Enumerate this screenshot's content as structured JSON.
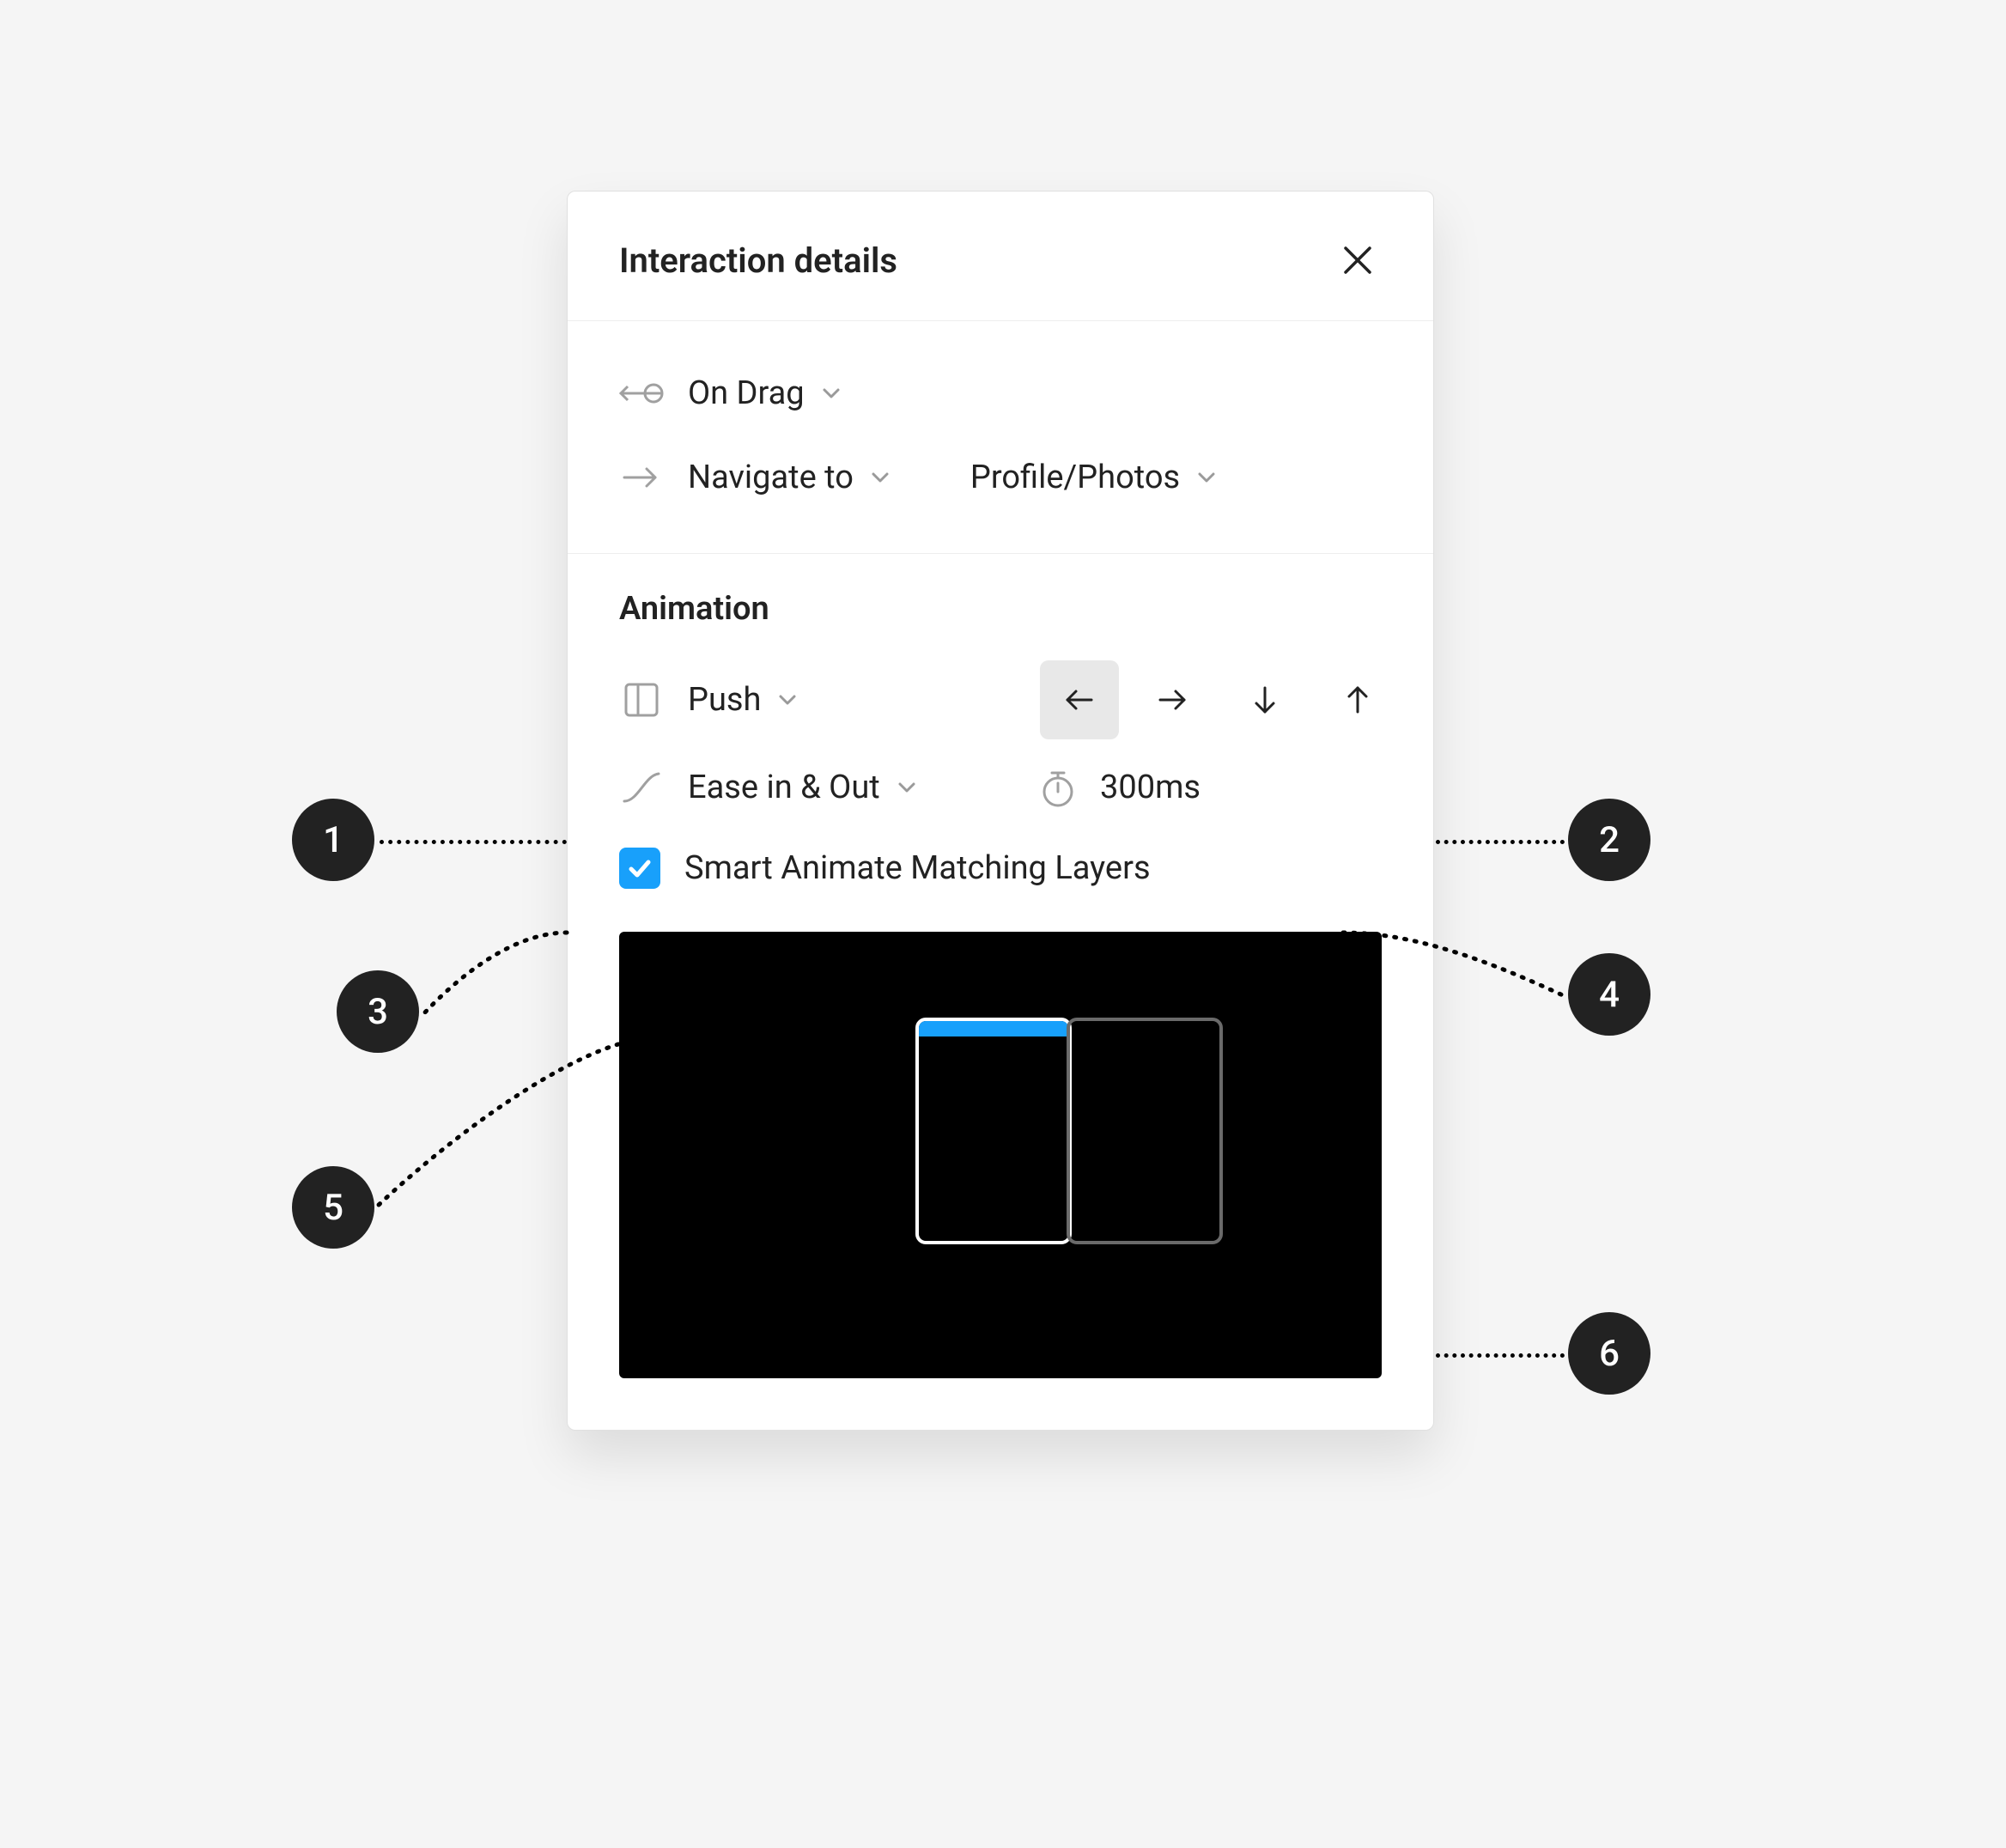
{
  "panel": {
    "title": "Interaction details"
  },
  "trigger": {
    "type_label": "On Drag",
    "action_label": "Navigate to",
    "destination_label": "Profile/Photos"
  },
  "animation": {
    "section_title": "Animation",
    "type_label": "Push",
    "easing_label": "Ease in & Out",
    "duration_label": "300ms",
    "smart_animate_label": "Smart Animate Matching Layers",
    "smart_animate_checked": true,
    "direction_selected": "left"
  },
  "callouts": {
    "c1": "1",
    "c2": "2",
    "c3": "3",
    "c4": "4",
    "c5": "5",
    "c6": "6"
  }
}
